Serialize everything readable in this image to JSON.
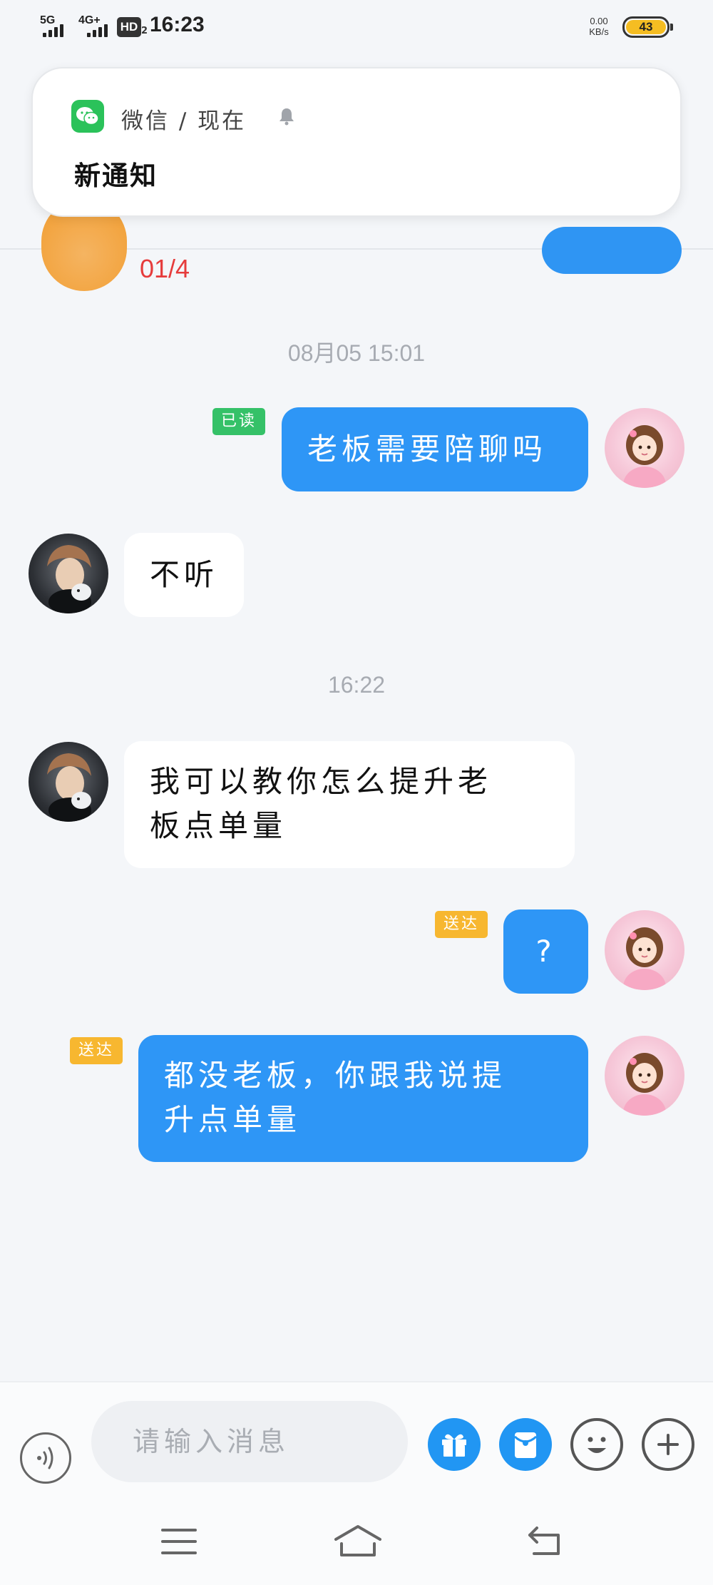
{
  "status_bar": {
    "network_1": "5G",
    "network_2": "4G+",
    "hd_badge": "HD",
    "hd_sub": "2",
    "time": "16:23",
    "net_speed_value": "0.00",
    "net_speed_unit": "KB/s",
    "battery": "43",
    "battery_level_percent": 43
  },
  "header": {
    "subtitle_fragment": "01/4"
  },
  "notification": {
    "app_icon": "wechat-icon",
    "app_name": "微信",
    "separator": "/",
    "time": "现在",
    "title": "新通知"
  },
  "messages": [
    {
      "type": "timestamp",
      "text": "08月05  15:01"
    },
    {
      "type": "outgoing",
      "text": "老板需要陪聊吗",
      "receipt": "已读",
      "receipt_color": "#35c168"
    },
    {
      "type": "incoming",
      "text": "不听"
    },
    {
      "type": "timestamp",
      "text": "16:22"
    },
    {
      "type": "incoming",
      "lines": [
        "我可以教你怎么提升老",
        "板点单量"
      ]
    },
    {
      "type": "outgoing",
      "text": "?",
      "receipt": "送达",
      "receipt_color": "#f7b730"
    },
    {
      "type": "outgoing",
      "lines": [
        "都没老板，你跟我说提",
        "升点单量"
      ],
      "receipt": "送达",
      "receipt_color": "#f7b730"
    }
  ],
  "input_bar": {
    "placeholder": "请输入消息",
    "buttons": [
      "voice-icon",
      "gift-icon",
      "red-packet-icon",
      "emoji-icon",
      "plus-icon"
    ]
  },
  "system_nav": [
    "menu-icon",
    "home-icon",
    "back-icon"
  ],
  "colors": {
    "accent": "#2e96f6",
    "read_receipt": "#35c168",
    "sent_receipt": "#f7b730",
    "background": "#f4f6f9"
  }
}
